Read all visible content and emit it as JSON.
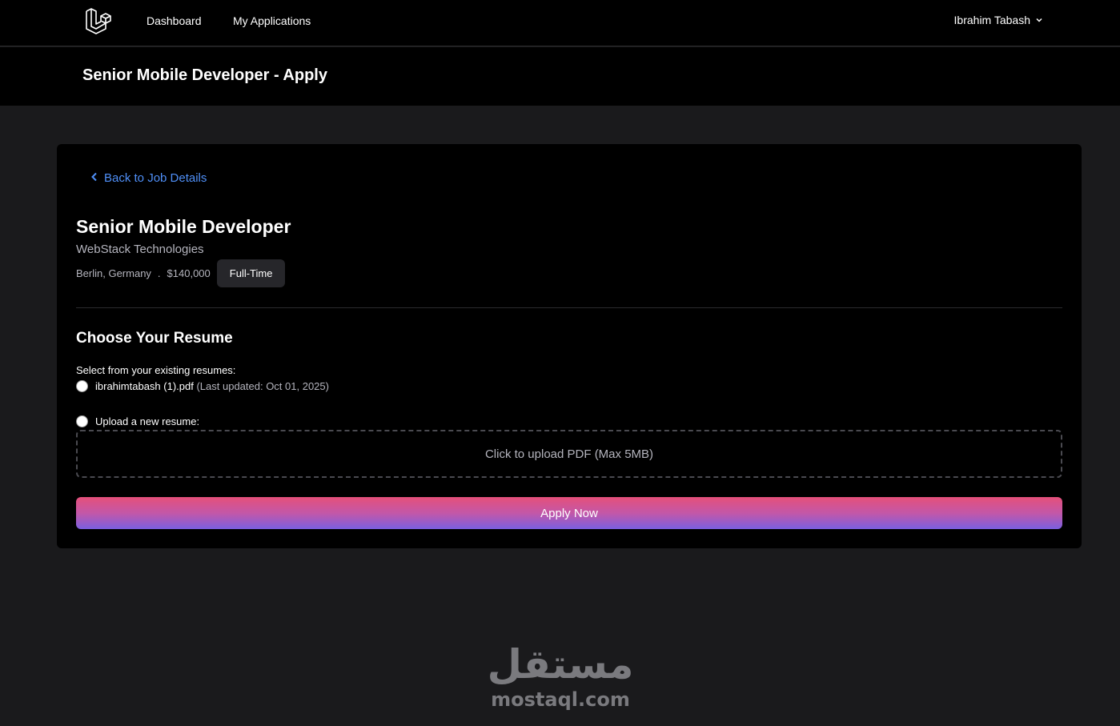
{
  "nav": {
    "logo_icon": "laravel-logo-icon",
    "links": [
      "Dashboard",
      "My Applications"
    ],
    "user_name": "Ibrahim Tabash",
    "user_menu_icon": "chevron-down-icon"
  },
  "header": {
    "title": "Senior Mobile Developer - Apply"
  },
  "job": {
    "back_label": "Back to Job Details",
    "title": "Senior Mobile Developer",
    "company": "WebStack Technologies",
    "location": "Berlin, Germany",
    "separator": ".",
    "salary": "$140,000",
    "type": "Full-Time"
  },
  "resume": {
    "section_title": "Choose Your Resume",
    "select_label": "Select from your existing resumes:",
    "existing_file": "ibrahimtabash (1).pdf",
    "existing_updated": "(Last updated: Oct 01, 2025)",
    "upload_label": "Upload a new resume:",
    "upload_prompt": "Click to upload PDF (Max 5MB)"
  },
  "actions": {
    "apply_label": "Apply Now"
  },
  "watermark": {
    "arabic": "مستقل",
    "latin": "mostaql.com"
  },
  "colors": {
    "link": "#4f8ff7",
    "gradient_top": "#e5507a",
    "gradient_bottom": "#7a5fe0",
    "background": "#1a1a1c",
    "card": "#000000"
  }
}
